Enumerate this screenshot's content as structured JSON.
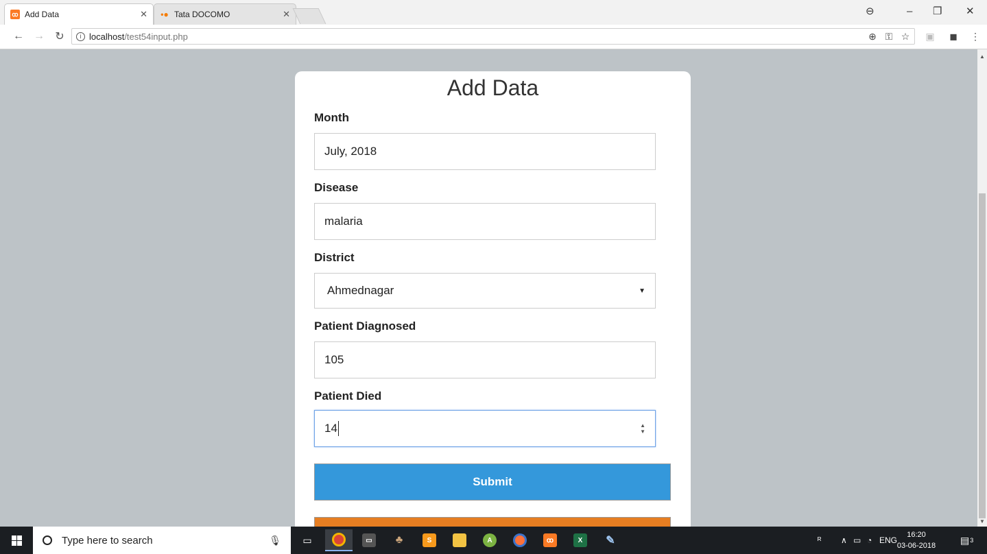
{
  "browser": {
    "tabs": [
      {
        "title": "Add Data",
        "favicon": "xampp-icon",
        "favicon_color": "#fb7a24"
      },
      {
        "title": "Tata DOCOMO",
        "favicon": "docomo-icon",
        "favicon_color": "#f57c00"
      }
    ],
    "url_host": "localhost",
    "url_path": "/test54input.php"
  },
  "page": {
    "heading": "Add Data",
    "fields": [
      {
        "label": "Month",
        "value": "July, 2018"
      },
      {
        "label": "Disease",
        "value": "malaria"
      },
      {
        "label": "District",
        "value": "Ahmednagar"
      },
      {
        "label": "Patient Diagnosed",
        "value": "105"
      },
      {
        "label": "Patient Died",
        "value": "14"
      }
    ],
    "submit_label": "Submit",
    "colors": {
      "submit": "#3498db",
      "second_button": "#e67e22",
      "background": "#bdc3c7"
    }
  },
  "taskbar": {
    "search_placeholder": "Type here to search",
    "language": "ENG",
    "time": "16:20",
    "date": "03-06-2018",
    "notification_count": "3"
  }
}
